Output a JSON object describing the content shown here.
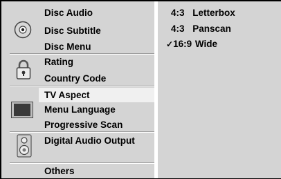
{
  "menu": {
    "groups": [
      {
        "icon": "disc-icon",
        "items": [
          "Disc Audio",
          "Disc Subtitle",
          "Disc Menu"
        ]
      },
      {
        "icon": "lock-icon",
        "items": [
          "Rating",
          "Country Code"
        ]
      },
      {
        "icon": "tv-icon",
        "items": [
          "TV Aspect",
          "Menu Language",
          "Progressive Scan"
        ]
      },
      {
        "icon": "speaker-icon",
        "items": [
          "Digital Audio Output"
        ]
      },
      {
        "icon": "",
        "items": [
          "Others"
        ]
      }
    ],
    "selected": "TV Aspect"
  },
  "options": {
    "items": [
      {
        "ratio": "4:3",
        "label": "Letterbox",
        "checked": false
      },
      {
        "ratio": "4:3",
        "label": "Panscan",
        "checked": false
      },
      {
        "ratio": "16:9",
        "label": "Wide",
        "checked": true
      }
    ],
    "check_mark": "✓"
  }
}
